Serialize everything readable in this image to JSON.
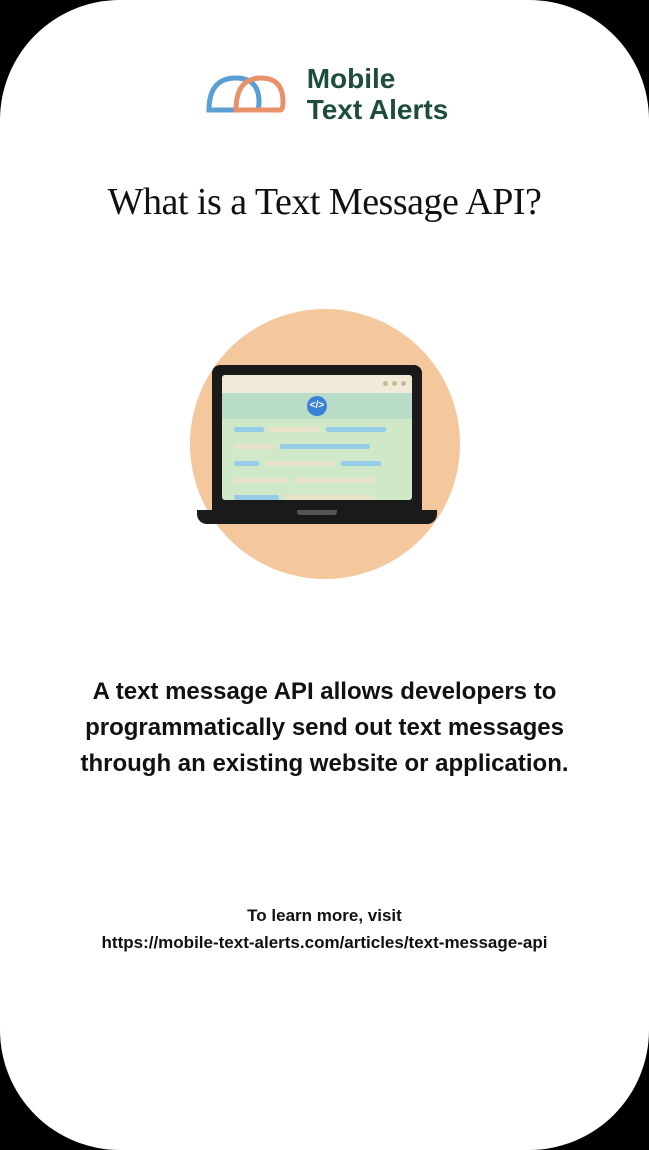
{
  "logo": {
    "line1": "Mobile",
    "line2": "Text Alerts"
  },
  "headline": "What is a Text Message API?",
  "illustration": {
    "icon_name": "laptop-code-icon",
    "code_symbol": "</>"
  },
  "description": "A text message API allows developers to programmatically send out text messages through an existing website or application.",
  "footer": {
    "intro": "To learn more, visit",
    "url": "https://mobile-text-alerts.com/articles/text-message-api"
  }
}
